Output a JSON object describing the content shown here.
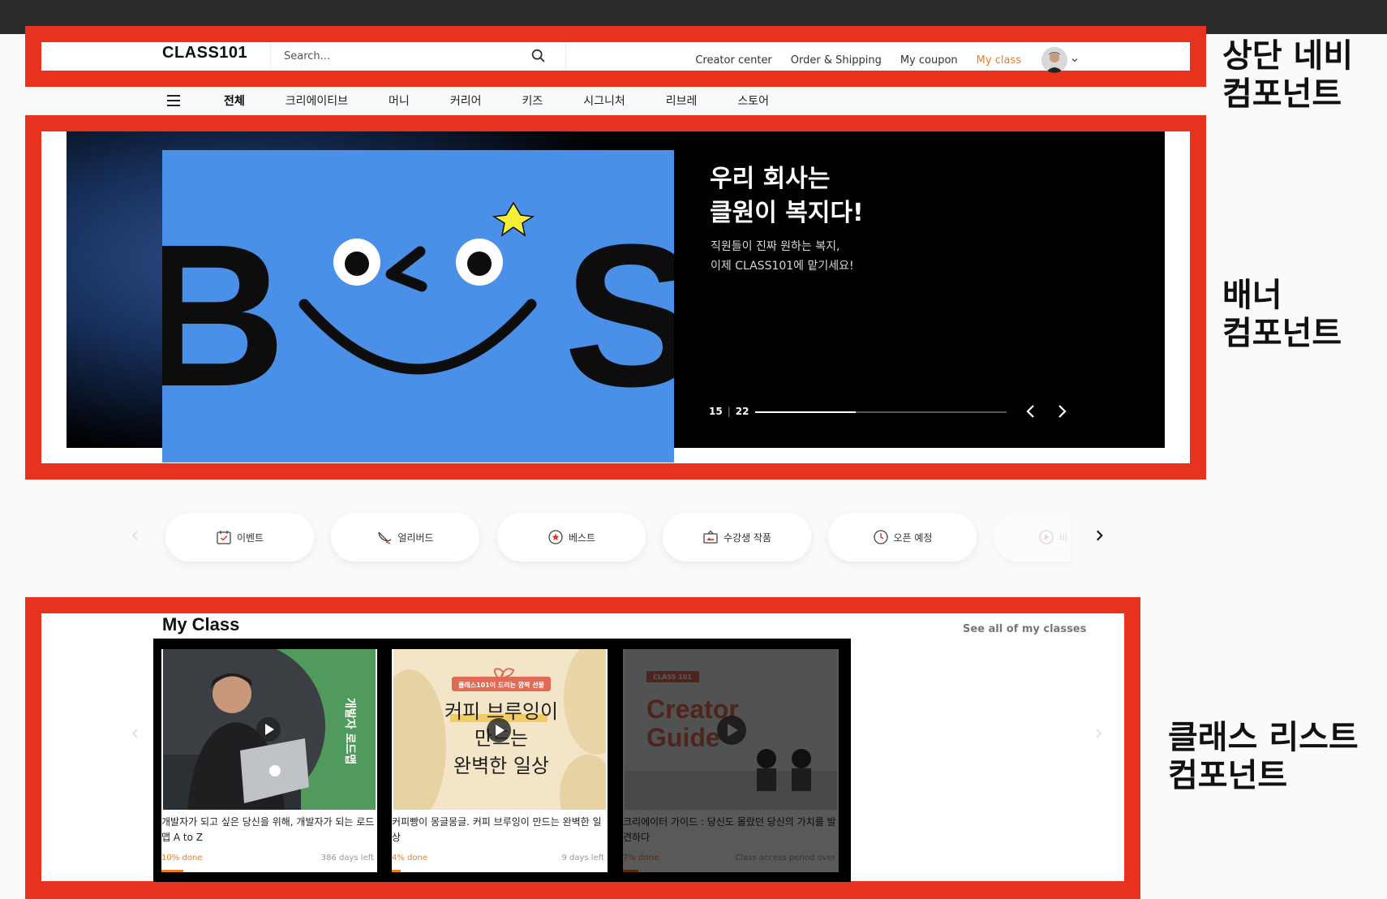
{
  "header": {
    "logo": "CLASS101",
    "search_placeholder": "Search...",
    "nav": [
      {
        "label": "Creator center"
      },
      {
        "label": "Order & Shipping"
      },
      {
        "label": "My coupon"
      },
      {
        "label": "My class"
      }
    ],
    "accent_color": "#f07c1e"
  },
  "categories": [
    "전체",
    "크리에이티브",
    "머니",
    "커리어",
    "키즈",
    "시그니처",
    "리브레",
    "스토어"
  ],
  "banner": {
    "title_line1": "우리 회사는",
    "title_line2": "클원이 복지다!",
    "sub_line1": "직원들이 진짜 원하는 복지,",
    "sub_line2": "이제 CLASS101에 맡기세요!",
    "current_slide": "15",
    "total_slides": "22",
    "progress_fraction": 0.4,
    "art_letters": [
      "B",
      "S"
    ]
  },
  "quick_menu": [
    {
      "label": "이벤트",
      "icon": "calendar-icon"
    },
    {
      "label": "얼리버드",
      "icon": "bird-icon"
    },
    {
      "label": "베스트",
      "icon": "star-badge-icon"
    },
    {
      "label": "수강생 작품",
      "icon": "gallery-icon"
    },
    {
      "label": "오픈 예정",
      "icon": "clock-icon"
    },
    {
      "label": "바",
      "icon": "play-icon"
    }
  ],
  "my_class": {
    "title": "My Class",
    "see_all": "See all of my classes",
    "cards": [
      {
        "title": "개발자가 되고 싶은 당신을 위해, 개발자가 되는 로드맵 A to Z",
        "done": "10% done",
        "days": "386 days left",
        "progress": 0.1,
        "thumb_text": "개발자 로드맵"
      },
      {
        "title": "커피빵이 몽글몽글. 커피 브루잉이 만드는 완벽한 일상",
        "done": "4% done",
        "days": "9 days left",
        "progress": 0.04,
        "thumb_badge": "클래스101이 드리는 깜짝 선물",
        "thumb_line1": "커피 브루잉이",
        "thumb_line2": "만드는",
        "thumb_line3": "완벽한 일상"
      },
      {
        "title": "크리에이터 가이드 : 당신도 몰랐던 당신의 가치를 발견하다",
        "done": "7% done",
        "days": "Class access period over",
        "progress": 0.07,
        "thumb_badge": "CLASS 101",
        "thumb_line1": "Creator",
        "thumb_line2": "Guide"
      }
    ]
  },
  "annotations": {
    "nav_line1": "상단 네비",
    "nav_line2": "컴포넌트",
    "banner_line1": "배너",
    "banner_line2": "컴포넌트",
    "list_line1": "클래스 리스트",
    "list_line2": "컴포넌트"
  },
  "frame_color": "#e8321e"
}
